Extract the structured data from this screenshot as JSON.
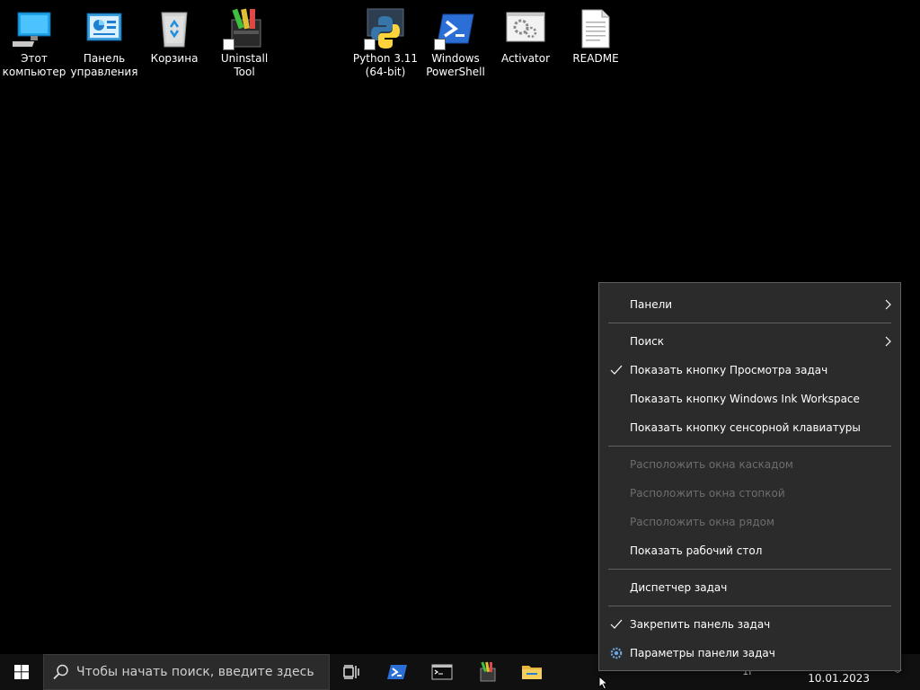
{
  "desktop": {
    "icons": [
      {
        "name": "this-pc",
        "label": "Этот\nкомпьютер"
      },
      {
        "name": "control-panel",
        "label": "Панель\nуправления"
      },
      {
        "name": "recycle-bin",
        "label": "Корзина"
      },
      {
        "name": "uninstall-tool",
        "label": "Uninstall Tool"
      },
      {
        "name": "python",
        "label": "Python 3.11\n(64-bit)"
      },
      {
        "name": "powershell",
        "label": "Windows\nPowerShell"
      },
      {
        "name": "activator",
        "label": "Activator"
      },
      {
        "name": "readme",
        "label": "README"
      }
    ]
  },
  "taskbar": {
    "search_placeholder": "Чтобы начать поиск, введите здесь",
    "date": "10.01.2023",
    "tray_text": "1Г"
  },
  "context_menu": {
    "items": [
      {
        "label": "Панели",
        "submenu": true
      },
      {
        "label": "Поиск",
        "submenu": true
      },
      {
        "label": "Показать кнопку Просмотра задач",
        "checked": true
      },
      {
        "label": "Показать кнопку Windows Ink Workspace"
      },
      {
        "label": "Показать кнопку сенсорной клавиатуры"
      },
      {
        "label": "Расположить окна каскадом",
        "disabled": true
      },
      {
        "label": "Расположить окна стопкой",
        "disabled": true
      },
      {
        "label": "Расположить окна рядом",
        "disabled": true
      },
      {
        "label": "Показать рабочий стол"
      },
      {
        "label": "Диспетчер задач"
      },
      {
        "label": "Закрепить панель задач",
        "checked": true
      },
      {
        "label": "Параметры панели задач",
        "icon": "gear-icon"
      }
    ]
  },
  "colors": {
    "desktop_bg": "#000000",
    "taskbar_bg": "#101010",
    "menu_bg": "#2b2b2b",
    "menu_disabled_text": "#6d6d6d",
    "accent_blue": "#1e90ff"
  }
}
